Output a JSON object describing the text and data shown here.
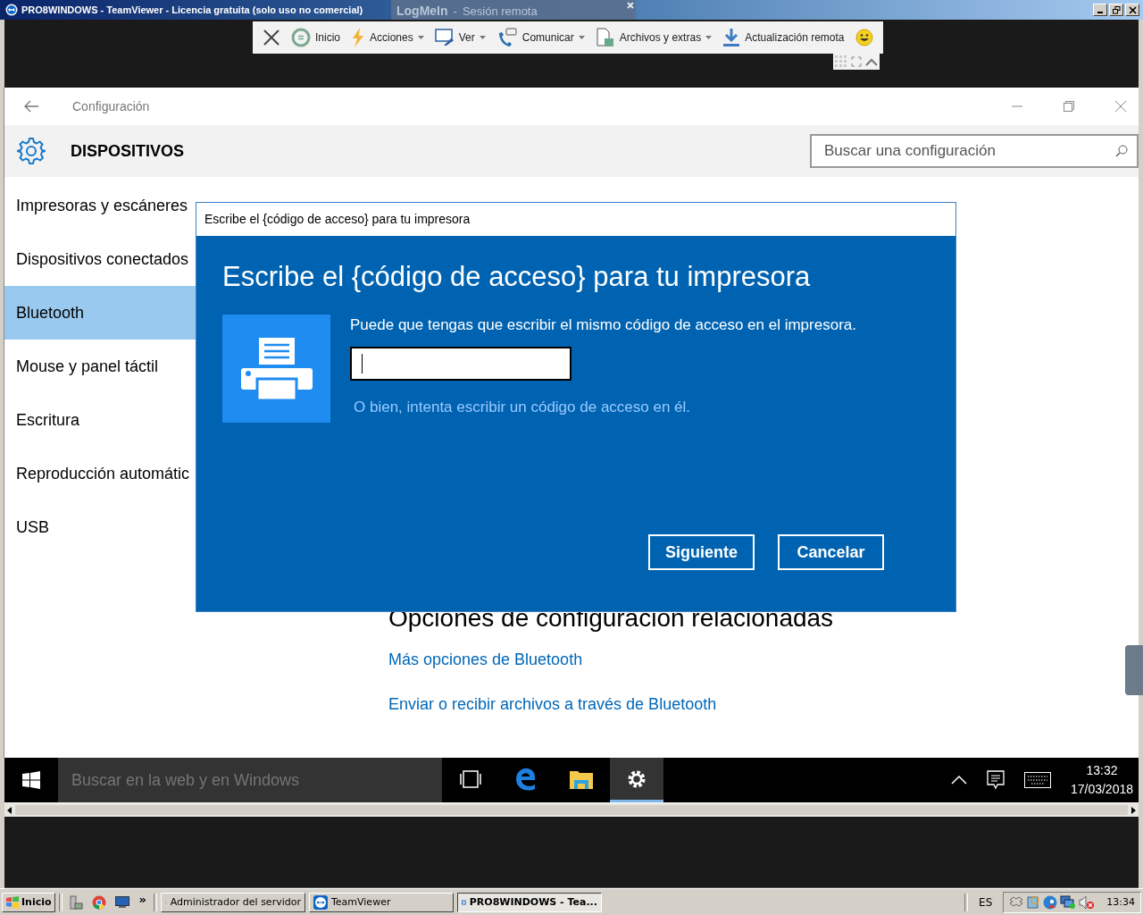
{
  "window": {
    "title": "PRO8WINDOWS - TeamViewer - Licencia gratuita (solo uso no comercial)"
  },
  "logmein": {
    "brand": "LogMeIn",
    "separator": "-",
    "label": "Sesión remota"
  },
  "toolbar": {
    "items": [
      {
        "kind": "close",
        "dropdown": false
      },
      {
        "kind": "home",
        "label": "Inicio",
        "dropdown": false
      },
      {
        "kind": "actions",
        "label": "Acciones",
        "dropdown": true
      },
      {
        "kind": "view",
        "label": "Ver",
        "dropdown": true
      },
      {
        "kind": "communicate",
        "label": "Comunicar",
        "dropdown": true
      },
      {
        "kind": "files",
        "label": "Archivos y extras",
        "dropdown": true
      },
      {
        "kind": "update",
        "label": "Actualización remota",
        "dropdown": false
      },
      {
        "kind": "feedback",
        "dropdown": false
      }
    ]
  },
  "settings": {
    "title": "Configuración",
    "heading": "DISPOSITIVOS",
    "search": {
      "placeholder": "Buscar una configuración"
    },
    "nav": [
      {
        "label": "Impresoras y escáneres",
        "selected": false
      },
      {
        "label": "Dispositivos conectados",
        "selected": false
      },
      {
        "label": "Bluetooth",
        "selected": true
      },
      {
        "label": "Mouse y panel táctil",
        "selected": false
      },
      {
        "label": "Escritura",
        "selected": false
      },
      {
        "label": "Reproducción automátic",
        "selected": false
      },
      {
        "label": "USB",
        "selected": false
      }
    ],
    "section_title": "Opciones de configuración relacionadas",
    "links": [
      "Más opciones de Bluetooth",
      "Enviar o recibir archivos a través de Bluetooth"
    ]
  },
  "dialog": {
    "title": "Escribe el {código de acceso} para tu impresora",
    "heading": "Escribe el {código de acceso} para tu impresora",
    "description": "Puede que tengas que escribir el mismo código de acceso en el impresora.",
    "alt_link": "O bien, intenta escribir un código de acceso en él.",
    "buttons": [
      {
        "label": "Siguiente"
      },
      {
        "label": "Cancelar"
      }
    ]
  },
  "win_taskbar": {
    "search_placeholder": "Buscar en la web y en Windows",
    "apps": [
      {
        "kind": "task-view",
        "active": false
      },
      {
        "kind": "edge",
        "active": false
      },
      {
        "kind": "explorer",
        "active": false
      },
      {
        "kind": "settings",
        "active": true
      }
    ],
    "time": "13:32",
    "date": "17/03/2018"
  },
  "host_taskbar": {
    "start": "Inicio",
    "quick_launch": [
      {
        "kind": "server"
      },
      {
        "kind": "chrome"
      },
      {
        "kind": "desktop"
      }
    ],
    "overflow": "»",
    "tasks": [
      {
        "label": "Administrador del servidor",
        "kind": "server",
        "selected": false
      },
      {
        "label": "TeamViewer",
        "kind": "teamviewer",
        "selected": false
      },
      {
        "label": "PRO8WINDOWS - Tea...",
        "kind": "teamviewer",
        "selected": true
      }
    ],
    "language": "ES",
    "clock": "13:34"
  }
}
